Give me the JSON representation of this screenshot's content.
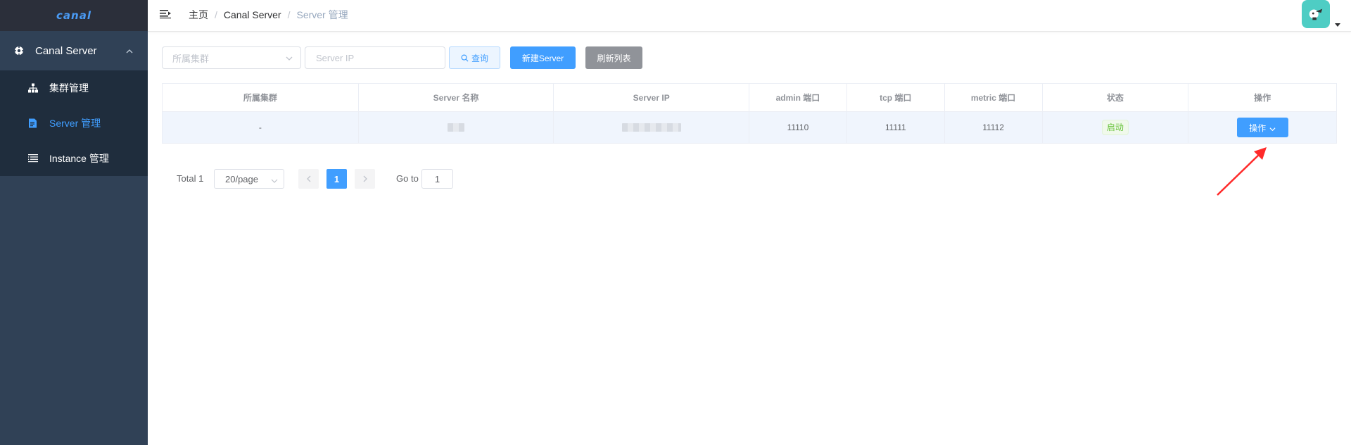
{
  "app": {
    "logo_text": "canal",
    "accent_color": "#409eff",
    "sidebar_bg": "#304156"
  },
  "sidebar": {
    "group": {
      "label": "Canal Server",
      "icon": "target-icon",
      "expanded": true
    },
    "items": [
      {
        "label": "集群管理",
        "icon": "cluster-icon",
        "active": false
      },
      {
        "label": "Server 管理",
        "icon": "document-icon",
        "active": true
      },
      {
        "label": "Instance 管理",
        "icon": "list-icon",
        "active": false
      }
    ]
  },
  "header": {
    "breadcrumb": [
      "主页",
      "Canal Server",
      "Server 管理"
    ],
    "separator": "/"
  },
  "toolbar": {
    "cluster_placeholder": "所属集群",
    "ip_placeholder": "Server IP",
    "query_label": "查询",
    "new_label": "新建Server",
    "refresh_label": "刷新列表"
  },
  "table": {
    "columns": [
      "所属集群",
      "Server 名称",
      "Server IP",
      "admin 端口",
      "tcp 端口",
      "metric 端口",
      "状态",
      "操作"
    ],
    "rows": [
      {
        "cluster": "-",
        "admin_port": "11110",
        "tcp_port": "11111",
        "metric_port": "11112",
        "status": "启动",
        "status_color": "#67c23a",
        "action_label": "操作"
      }
    ]
  },
  "pagination": {
    "total_text": "Total 1",
    "page_size": "20/page",
    "current_page": "1",
    "goto_label": "Go to",
    "goto_value": "1"
  }
}
